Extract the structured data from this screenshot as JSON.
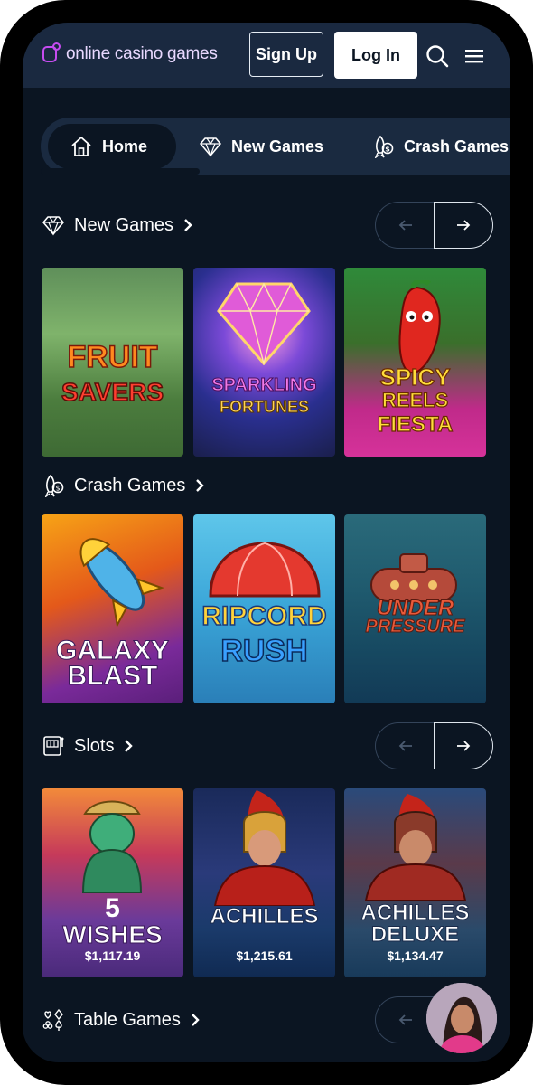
{
  "header": {
    "logo_text": "online casino games",
    "signup_label": "Sign Up",
    "login_label": "Log In"
  },
  "nav": {
    "items": [
      {
        "label": "Home",
        "icon": "home-icon"
      },
      {
        "label": "New Games",
        "icon": "diamond-icon"
      },
      {
        "label": "Crash Games",
        "icon": "rocket-coin-icon"
      }
    ]
  },
  "sections": {
    "new_games": {
      "title": "New Games",
      "icon": "diamond-icon"
    },
    "crash_games": {
      "title": "Crash Games",
      "icon": "rocket-coin-icon"
    },
    "slots": {
      "title": "Slots",
      "icon": "slot-machine-icon"
    },
    "table_games": {
      "title": "Table Games",
      "icon": "card-suits-icon"
    }
  },
  "games": {
    "new": [
      {
        "title_line1": "FRUIT",
        "title_line2": "SAVERS"
      },
      {
        "title_line1": "SPARKLING",
        "title_line2": "FORTUNES"
      },
      {
        "title_line1": "SPICY",
        "title_line2": "REELS",
        "title_line3": "FIESTA"
      }
    ],
    "crash": [
      {
        "title_line1": "GALAXY",
        "title_line2": "BLAST"
      },
      {
        "title_line1": "RIPCORD",
        "title_line2": "RUSH"
      },
      {
        "title_line1": "UNDER",
        "title_line2": "PRESSURE"
      }
    ],
    "slots": [
      {
        "title_line1": "5",
        "title_line2": "WISHES",
        "jackpot": "$1,117.19"
      },
      {
        "title_line1": "ACHILLES",
        "jackpot": "$1,215.61"
      },
      {
        "title_line1": "ACHILLES",
        "title_line2": "DELUXE",
        "jackpot": "$1,134.47"
      }
    ]
  },
  "colors": {
    "header_bg": "#1a2940",
    "page_bg": "#0b1522",
    "logo_accent": "#c64cf0"
  }
}
